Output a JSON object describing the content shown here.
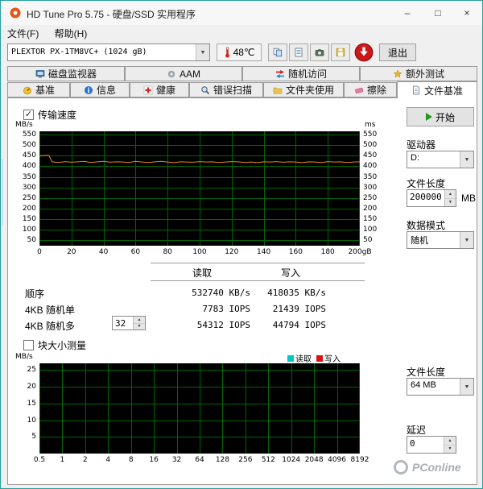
{
  "window": {
    "title": "HD Tune Pro 5.75 - 硬盘/SSD 实用程序",
    "controls": {
      "minimize": "–",
      "maximize": "□",
      "close": "×"
    }
  },
  "menu": {
    "items": [
      {
        "label": "文件(F)"
      },
      {
        "label": "帮助(H)"
      }
    ]
  },
  "toolbar": {
    "device_select": "PLEXTOR PX-1TM8VC+ (1024 gB)",
    "temperature": "48℃",
    "exit_label": "退出"
  },
  "tabs": {
    "row1": [
      {
        "label": "磁盘监视器"
      },
      {
        "label": "AAM"
      },
      {
        "label": "随机访问"
      },
      {
        "label": "额外测试"
      }
    ],
    "row2": [
      {
        "label": "基准"
      },
      {
        "label": "信息"
      },
      {
        "label": "健康"
      },
      {
        "label": "错误扫描"
      },
      {
        "label": "文件夹使用"
      },
      {
        "label": "擦除"
      },
      {
        "label": "文件基准"
      }
    ],
    "active": "文件基准"
  },
  "benchmark": {
    "table": {
      "col_read": "读取",
      "col_write": "写入",
      "rows": [
        {
          "label": "顺序",
          "read": "532740 KB/s",
          "write": "418035 KB/s"
        },
        {
          "label": "4KB 随机单",
          "read": "7783 IOPS",
          "write": "21439 IOPS"
        },
        {
          "label": "4KB 随机多",
          "read": "54312 IOPS",
          "write": "44794 IOPS",
          "queue": "32"
        }
      ]
    }
  },
  "sidebar": {
    "start": "开始",
    "drive_label": "驱动器",
    "drive_value": "D:",
    "filelen_label": "文件长度",
    "filelen_value": "200000",
    "filelen_unit": "MB",
    "datamode_label": "数据模式",
    "datamode_value": "随机",
    "filelen2_label": "文件长度",
    "filelen2_value": "64 MB",
    "latency_label": "延迟",
    "latency_value": "0"
  },
  "watermark": {
    "text": "PConline"
  },
  "chart_data": [
    {
      "type": "line",
      "title": "传输速度",
      "ylabel": "MB/s",
      "ylabel_right": "ms",
      "ylim": [
        25,
        565
      ],
      "y_ticks": [
        50,
        100,
        150,
        200,
        250,
        300,
        350,
        400,
        450,
        500,
        550
      ],
      "xlim": [
        0,
        200
      ],
      "x_tick_values": [
        0,
        20,
        40,
        60,
        80,
        100,
        120,
        140,
        160,
        180,
        200
      ],
      "x_tick_labels": [
        "0",
        "20",
        "40",
        "60",
        "80",
        "100",
        "120",
        "140",
        "160",
        "180",
        "200gB"
      ],
      "grid_color": "#006600",
      "bg_color": "#000000",
      "series": [
        {
          "name": "传输速度",
          "color": "#e0832c",
          "points": [
            [
              0,
              446
            ],
            [
              1,
              451
            ],
            [
              2,
              449
            ],
            [
              3,
              452
            ],
            [
              4,
              450
            ],
            [
              5,
              453
            ],
            [
              6,
              450
            ],
            [
              7,
              434
            ],
            [
              8,
              421
            ],
            [
              12,
              418
            ],
            [
              16,
              422
            ],
            [
              20,
              419
            ],
            [
              24,
              421
            ],
            [
              28,
              423
            ],
            [
              32,
              418
            ],
            [
              36,
              421
            ],
            [
              40,
              423
            ],
            [
              44,
              419
            ],
            [
              48,
              421
            ],
            [
              52,
              420
            ],
            [
              56,
              418
            ],
            [
              60,
              423
            ],
            [
              64,
              420
            ],
            [
              68,
              418
            ],
            [
              72,
              421
            ],
            [
              76,
              423
            ],
            [
              80,
              420
            ],
            [
              84,
              417
            ],
            [
              88,
              421
            ],
            [
              92,
              420
            ],
            [
              96,
              419
            ],
            [
              100,
              422
            ],
            [
              104,
              420
            ],
            [
              108,
              421
            ],
            [
              112,
              418
            ],
            [
              116,
              420
            ],
            [
              120,
              422
            ],
            [
              124,
              421
            ],
            [
              128,
              418
            ],
            [
              132,
              420
            ],
            [
              136,
              417
            ],
            [
              140,
              421
            ],
            [
              144,
              420
            ],
            [
              148,
              422
            ],
            [
              152,
              419
            ],
            [
              156,
              421
            ],
            [
              160,
              420
            ],
            [
              164,
              417
            ],
            [
              168,
              421
            ],
            [
              172,
              420
            ],
            [
              176,
              418
            ],
            [
              180,
              422
            ],
            [
              184,
              420
            ],
            [
              188,
              421
            ],
            [
              192,
              418
            ],
            [
              196,
              420
            ],
            [
              200,
              421
            ]
          ]
        }
      ]
    },
    {
      "type": "line",
      "title": "块大小测量",
      "ylabel": "MB/s",
      "ylim": [
        0,
        27
      ],
      "y_ticks": [
        5,
        10,
        15,
        20,
        25
      ],
      "x_tick_labels": [
        "0.5",
        "1",
        "2",
        "4",
        "8",
        "16",
        "32",
        "64",
        "128",
        "256",
        "512",
        "1024",
        "2048",
        "4096",
        "8192"
      ],
      "grid_color": "#006600",
      "bg_color": "#000000",
      "legend": [
        {
          "name": "读取",
          "color": "#00c8c8"
        },
        {
          "name": "写入",
          "color": "#dd1111"
        }
      ],
      "series": []
    }
  ]
}
